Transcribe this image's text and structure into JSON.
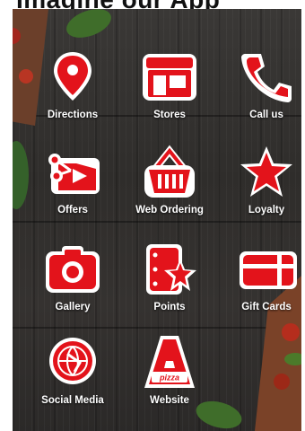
{
  "header": {
    "title": "Imagine our App"
  },
  "menu": {
    "items": [
      {
        "label": "Directions",
        "icon": "location-pin-icon"
      },
      {
        "label": "Stores",
        "icon": "storefront-icon"
      },
      {
        "label": "Call us",
        "icon": "phone-icon"
      },
      {
        "label": "Offers",
        "icon": "coupon-scissors-icon"
      },
      {
        "label": "Web Ordering",
        "icon": "shopping-basket-icon"
      },
      {
        "label": "Loyalty",
        "icon": "star-icon"
      },
      {
        "label": "Gallery",
        "icon": "camera-icon"
      },
      {
        "label": "Points",
        "icon": "star-card-icon"
      },
      {
        "label": "Gift Cards",
        "icon": "gift-card-icon"
      },
      {
        "label": "Social Media",
        "icon": "globe-icon"
      },
      {
        "label": "Website",
        "icon": "pizza-logo-icon"
      }
    ],
    "logo_text": "pizza"
  },
  "colors": {
    "accent": "#e3131b",
    "background": "#33312f",
    "label": "#ffffff"
  }
}
